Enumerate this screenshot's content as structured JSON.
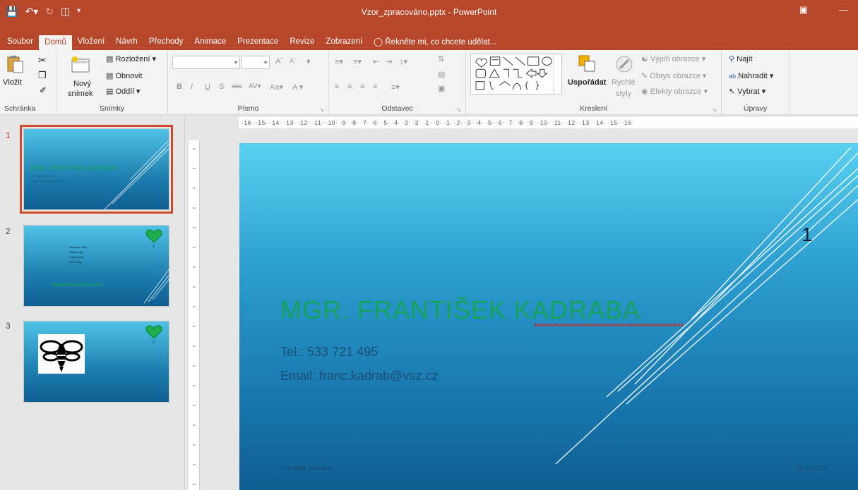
{
  "window": {
    "title": "Vzor_zpracováno.pptx - PowerPoint"
  },
  "tabs": [
    "Soubor",
    "Domů",
    "Vložení",
    "Návrh",
    "Přechody",
    "Animace",
    "Prezentace",
    "Revize",
    "Zobrazení"
  ],
  "active_tab": "Domů",
  "tell_me": "Řekněte mi, co chcete udělat...",
  "ribbon": {
    "clipboard": {
      "label": "Schránka",
      "paste": "Vložit"
    },
    "slides": {
      "label": "Snímky",
      "new_slide_1": "Nový",
      "new_slide_2": "snímek",
      "layout": "Rozložení",
      "reset": "Obnovit",
      "section": "Oddíl"
    },
    "font": {
      "label": "Písmo"
    },
    "paragraph": {
      "label": "Odstavec"
    },
    "drawing": {
      "label": "Kreslení",
      "arrange": "Uspořádat",
      "quick_styles_1": "Rychlé",
      "quick_styles_2": "styly",
      "fill": "Výplň obrazce",
      "outline": "Obrys obrazce",
      "effects": "Efekty obrazce"
    },
    "editing": {
      "label": "Úpravy",
      "find": "Najít",
      "replace": "Nahradit",
      "select": "Vybrat"
    }
  },
  "ruler": {
    "horizontal": "·16· ·15· ·14· ·13· ·12· ·11· ·10· ·9· ·8· ·7· ·6· ·5· ·4· ·3· ·2· ·1· ·0· ·1· ·2· ·3· ·4· ·5· ·6· ·7· ·8· ·9· ·10· ·11· ·12· ·13· ·14· ·15· ·16·"
  },
  "thumbnails": [
    {
      "num": "1",
      "title": "MGR. FRANTIŠEK KADRABA",
      "line1": "Tel.: 533 721 495",
      "line2": "Email: franc.kadrab@vsz.cz"
    },
    {
      "num": "2",
      "page": "2",
      "heading": "Hodnotitelské úlohy",
      "bullets": [
        "Nastavení úlohy",
        "Obsah úlohy",
        "Průběh úlohy",
        "Závěr úlohy"
      ]
    },
    {
      "num": "3",
      "page": "3"
    }
  ],
  "slide": {
    "title": "MGR. FRANTIŠEK KADRABA",
    "phone": "Tel.: 533 721 495",
    "email": "Email: franc.kadrab@vsz.cz",
    "page_number": "1",
    "footer_left": "František Kadraba",
    "footer_right": "13.10.2020"
  },
  "colors": {
    "accent": "#b7472a",
    "title_green": "#14a35a",
    "heart_green": "#1fae4d"
  }
}
